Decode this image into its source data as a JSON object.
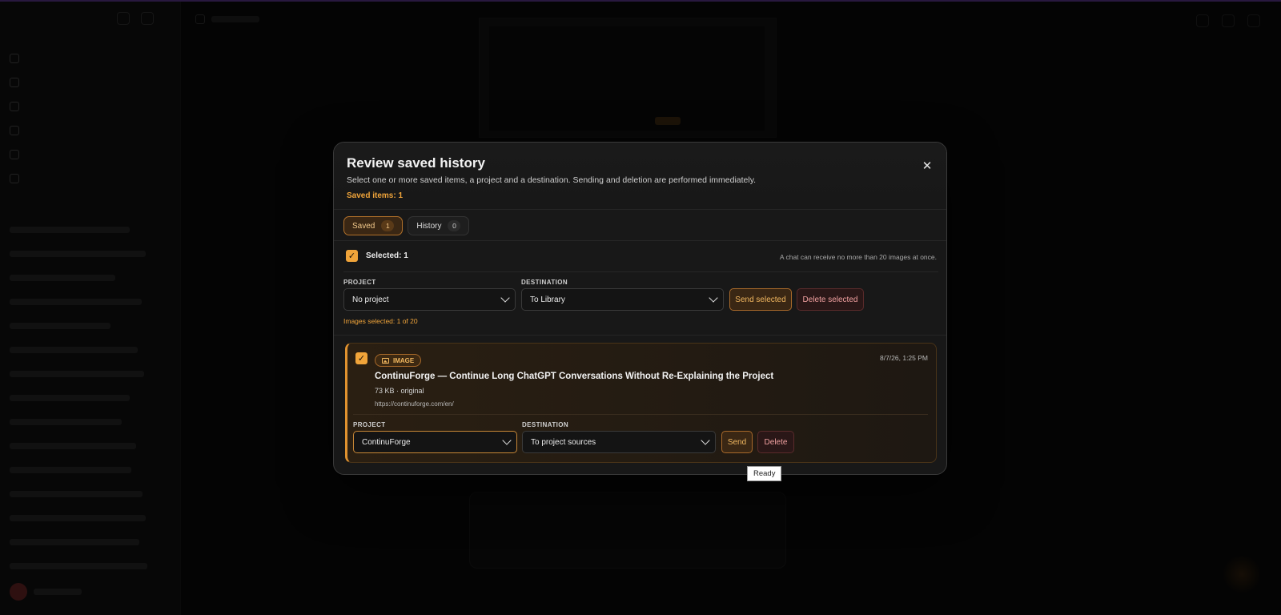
{
  "modal": {
    "title": "Review saved history",
    "subtitle": "Select one or more saved items, a project and a destination. Sending and deletion are performed immediately.",
    "saved_count_label": "Saved items: 1",
    "close_glyph": "✕",
    "tabs": [
      {
        "label": "Saved",
        "count": "1",
        "active": true
      },
      {
        "label": "History",
        "count": "0",
        "active": false
      }
    ],
    "selection": {
      "checked": true,
      "label": "Selected: 1",
      "limit_note": "A chat can receive no more than 20 images at once."
    },
    "bulk": {
      "project_label": "PROJECT",
      "project_value": "No project",
      "destination_label": "DESTINATION",
      "destination_value": "To Library",
      "send_label": "Send selected",
      "delete_label": "Delete selected",
      "images_selected": "Images selected: 1 of 20"
    },
    "items": [
      {
        "checked": true,
        "badge": "IMAGE",
        "badge_icon": "image-icon",
        "date": "8/7/26, 1:25 PM",
        "title": "ContinuForge — Continue Long ChatGPT Conversations Without Re-Explaining the Project",
        "meta": "73 KB · original",
        "url": "https://continuforge.com/en/",
        "project_label": "PROJECT",
        "project_value": "ContinuForge",
        "destination_label": "DESTINATION",
        "destination_value": "To project sources",
        "send_label": "Send",
        "delete_label": "Delete"
      }
    ]
  },
  "tooltip": "Ready",
  "colors": {
    "accent": "#f0a43a",
    "accent_border": "#a8692a",
    "danger_text": "#f0a0a0",
    "top_bar": "#6b3fa6"
  }
}
